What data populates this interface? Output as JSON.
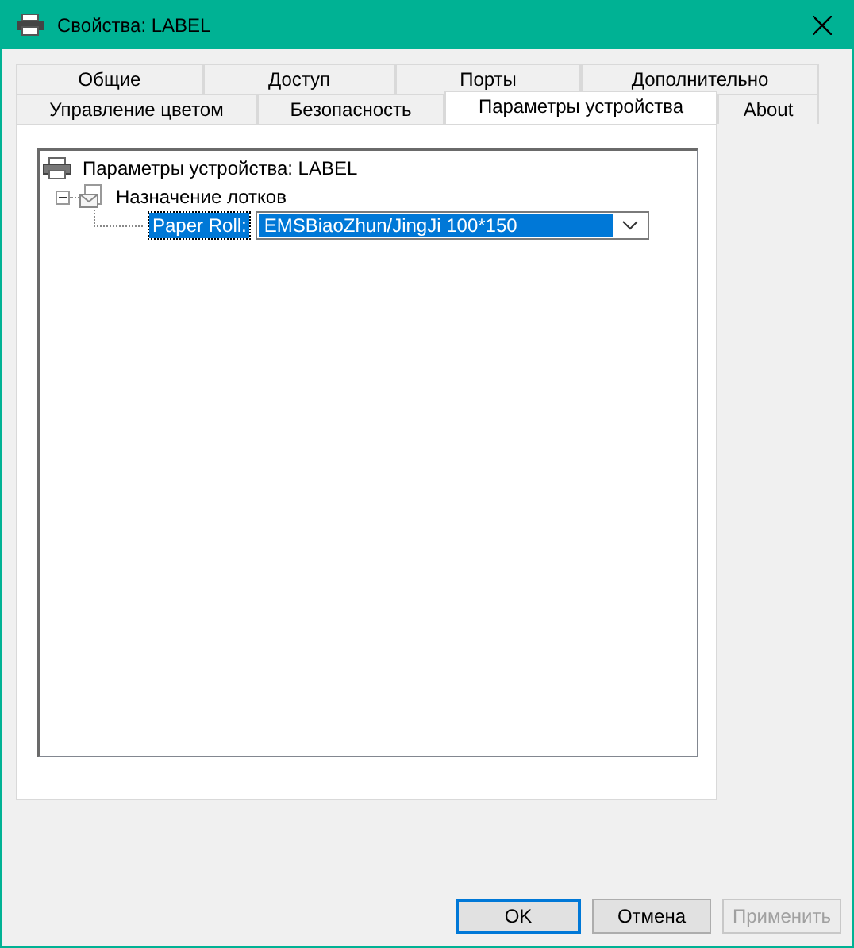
{
  "window": {
    "title": "Свойства: LABEL"
  },
  "tab_rows": [
    [
      {
        "label": "Общие",
        "selected": false
      },
      {
        "label": "Доступ",
        "selected": false
      },
      {
        "label": "Порты",
        "selected": false
      },
      {
        "label": "Дополнительно",
        "selected": false
      }
    ],
    [
      {
        "label": "Управление цветом",
        "selected": false
      },
      {
        "label": "Безопасность",
        "selected": false
      },
      {
        "label": "Параметры устройства",
        "selected": true
      },
      {
        "label": "About",
        "selected": false
      }
    ]
  ],
  "tree": [
    {
      "kind": "printer",
      "label": "Параметры устройства: LABEL",
      "children": [
        {
          "kind": "tray",
          "label": "Назначение лотков",
          "expanded": true,
          "children": [
            {
              "kind": "setting",
              "label": "Paper Roll:",
              "value": "EMSBiaoZhun/JingJi 100*150",
              "selected": true
            }
          ]
        }
      ]
    }
  ],
  "buttons": [
    {
      "label": "OK",
      "default": true,
      "disabled": false
    },
    {
      "label": "Отмена",
      "default": false,
      "disabled": false
    },
    {
      "label": "Применить",
      "default": false,
      "disabled": true
    }
  ]
}
